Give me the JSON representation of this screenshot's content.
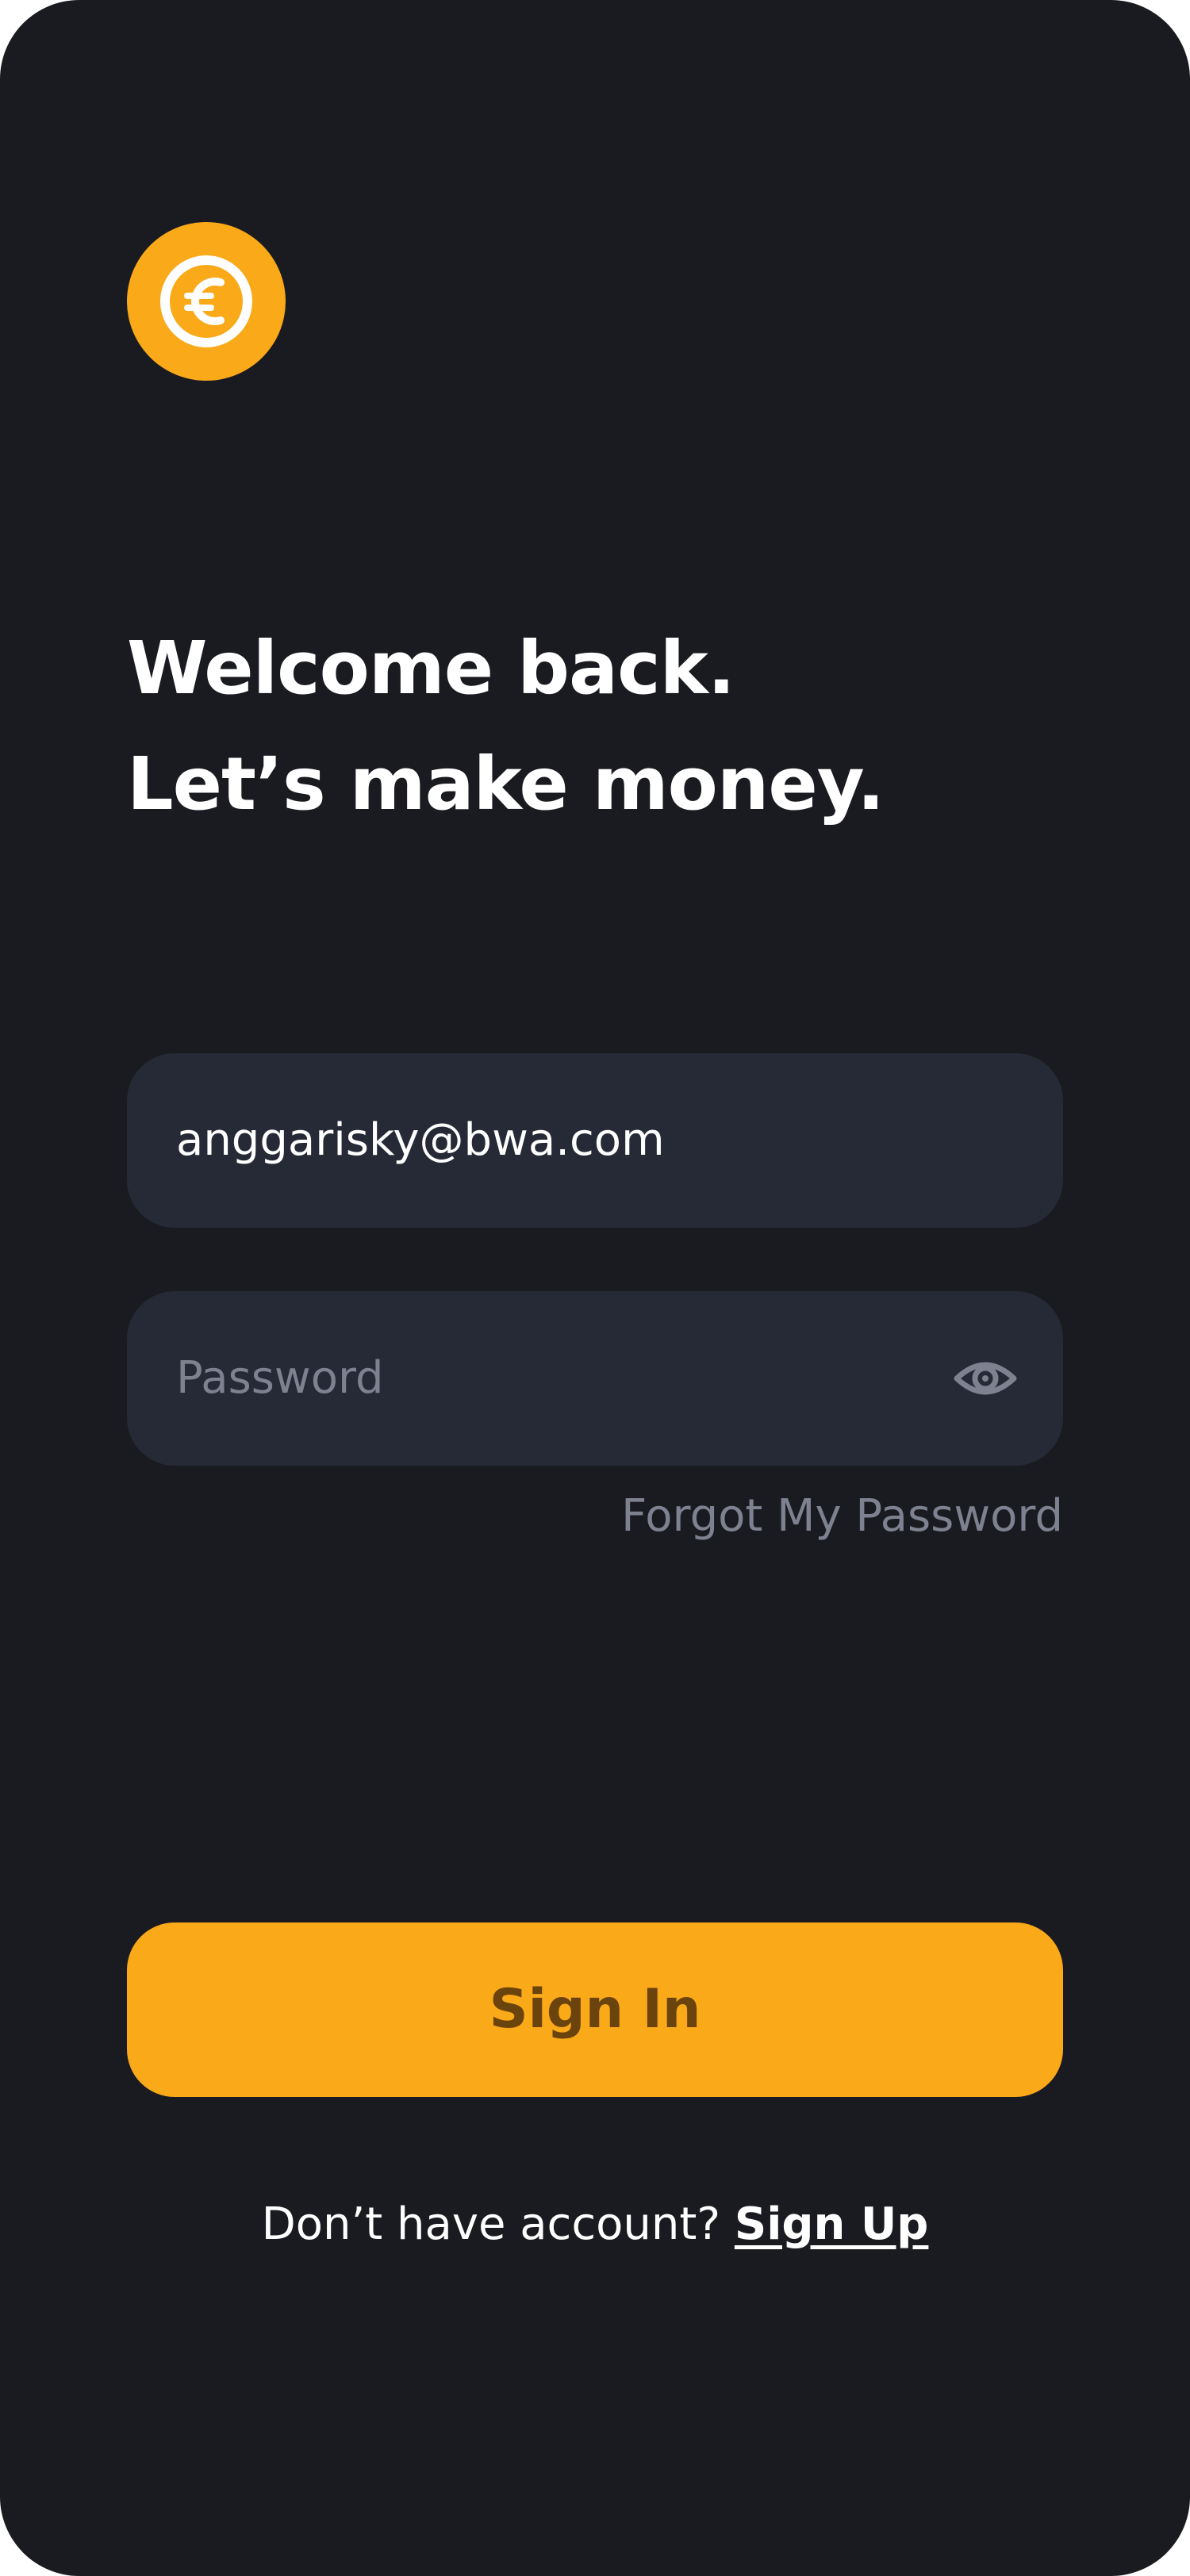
{
  "colors": {
    "background": "#1a1b20",
    "accent": "#faa919",
    "field_bg": "#262a36",
    "muted_text": "#7d8190",
    "button_text": "#6b430d"
  },
  "logo": {
    "icon": "euro-coin-icon"
  },
  "headline": {
    "line1": "Welcome back.",
    "line2": "Let’s make money."
  },
  "form": {
    "email": {
      "value": "anggarisky@bwa.com"
    },
    "password": {
      "placeholder": "Password",
      "toggle_icon": "eye-icon"
    },
    "forgot_label": "Forgot My Password"
  },
  "signin_label": "Sign In",
  "footer": {
    "prompt": "Don’t have account?",
    "signup_label": "Sign Up"
  }
}
